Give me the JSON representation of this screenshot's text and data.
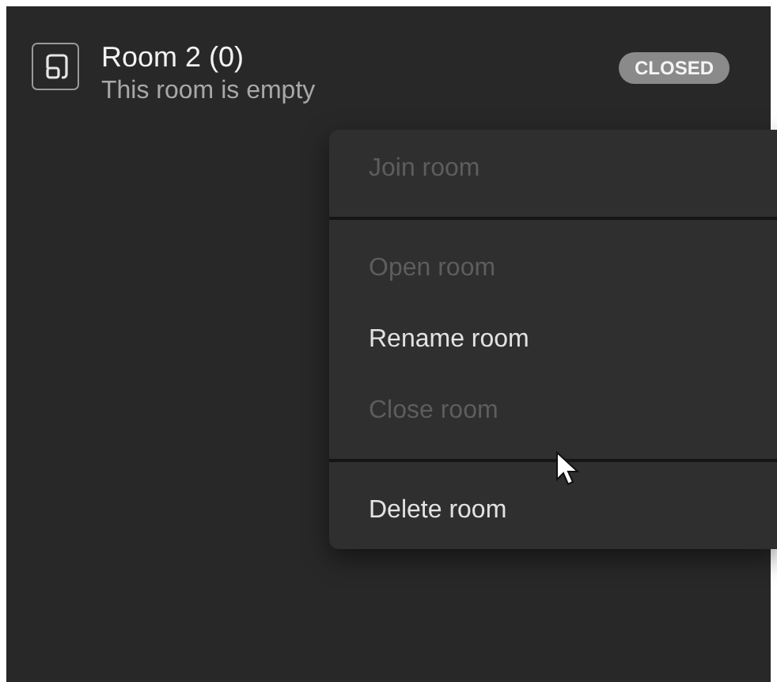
{
  "room": {
    "title": "Room 2 (0)",
    "subtitle": "This room is empty",
    "badge": "CLOSED"
  },
  "menu": {
    "groups": [
      {
        "items": [
          {
            "label": "Join room",
            "disabled": true
          }
        ]
      },
      {
        "items": [
          {
            "label": "Open room",
            "disabled": true
          },
          {
            "label": "Rename room",
            "disabled": false
          },
          {
            "label": "Close room",
            "disabled": true
          }
        ]
      },
      {
        "items": [
          {
            "label": "Delete room",
            "disabled": false
          }
        ]
      }
    ]
  }
}
